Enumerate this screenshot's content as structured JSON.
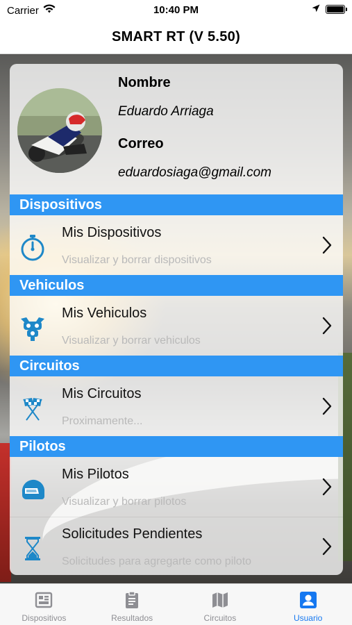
{
  "status": {
    "carrier": "Carrier",
    "time": "10:40 PM"
  },
  "header": {
    "title": "SMART RT (V 5.50)"
  },
  "profile": {
    "name_label": "Nombre",
    "name_value": "Eduardo Arriaga",
    "email_label": "Correo",
    "email_value": "eduardosiaga@gmail.com"
  },
  "sections": [
    {
      "title": "Dispositivos",
      "rows": [
        {
          "title": "Mis Dispositivos",
          "subtitle": "Visualizar y borrar dispositivos",
          "icon": "stopwatch-icon"
        }
      ]
    },
    {
      "title": "Vehiculos",
      "rows": [
        {
          "title": "Mis Vehiculos",
          "subtitle": "Visualizar y borrar vehiculos",
          "icon": "motorcycle-icon"
        }
      ]
    },
    {
      "title": "Circuitos",
      "rows": [
        {
          "title": "Mis Circuitos",
          "subtitle": "Proximamente...",
          "icon": "checkered-flags-icon"
        }
      ]
    },
    {
      "title": "Pilotos",
      "rows": [
        {
          "title": "Mis Pilotos",
          "subtitle": "Visualizar y borrar pilotos",
          "icon": "helmet-icon"
        },
        {
          "title": "Solicitudes Pendientes",
          "subtitle": "Solicitudes para agregarte como piloto",
          "icon": "hourglass-icon"
        }
      ]
    }
  ],
  "tabs": [
    {
      "label": "Dispositivos",
      "icon": "dashboard-icon",
      "active": false
    },
    {
      "label": "Resultados",
      "icon": "clipboard-icon",
      "active": false
    },
    {
      "label": "Circuitos",
      "icon": "map-icon",
      "active": false
    },
    {
      "label": "Usuario",
      "icon": "user-icon",
      "active": true
    }
  ],
  "colors": {
    "accent": "#2f96f3",
    "tab_active": "#1678f0",
    "tab_inactive": "#8e8e93",
    "icon_blue": "#1e88c8"
  }
}
